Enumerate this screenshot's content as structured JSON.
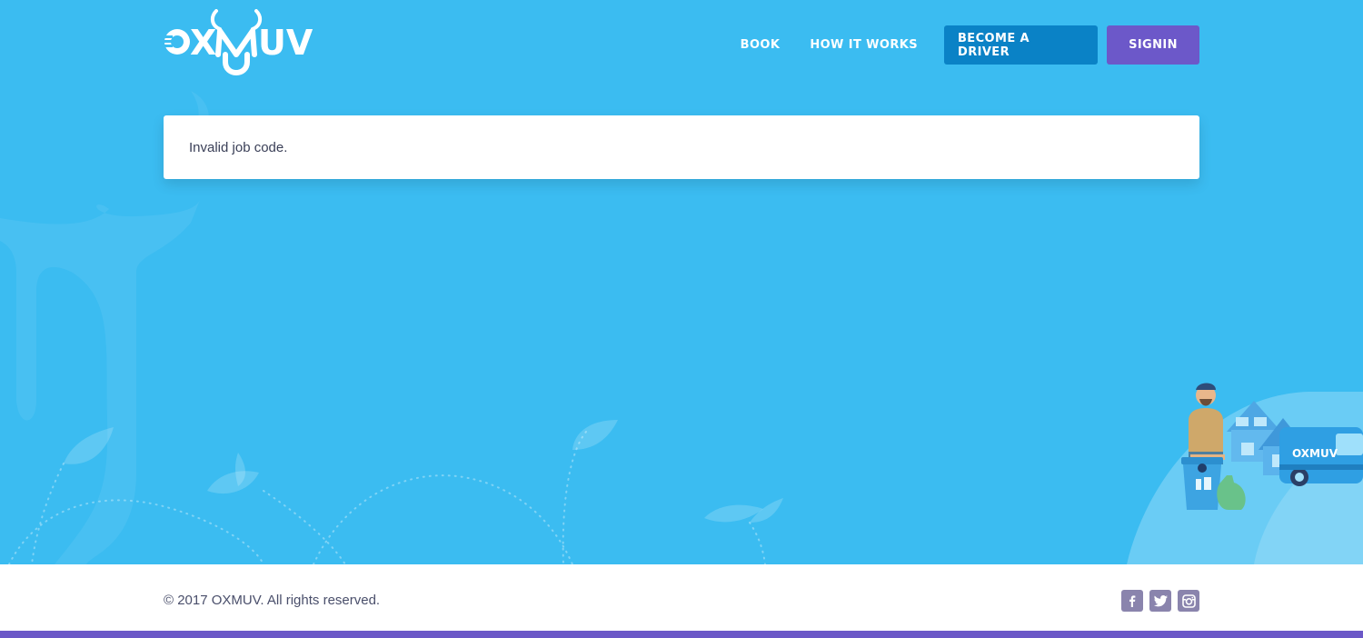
{
  "brand": {
    "name": "OXMUV"
  },
  "nav": {
    "links": [
      "BOOK",
      "HOW IT WORKS"
    ],
    "driver_button": "BECOME A DRIVER",
    "signin_button": "SIGNIN"
  },
  "alert": {
    "message": "Invalid job code."
  },
  "illustration": {
    "van_label": "OXMUV"
  },
  "footer": {
    "copyright": "© 2017 OXMUV. All rights reserved.",
    "social_icons": [
      "facebook-icon",
      "twitter-icon",
      "instagram-icon"
    ]
  },
  "colors": {
    "background": "#3bbcf1",
    "driver_button": "#0a82c6",
    "signin_button": "#6c58c9",
    "footer_bar": "#6b58c7",
    "social_icon": "#8a84ad"
  }
}
